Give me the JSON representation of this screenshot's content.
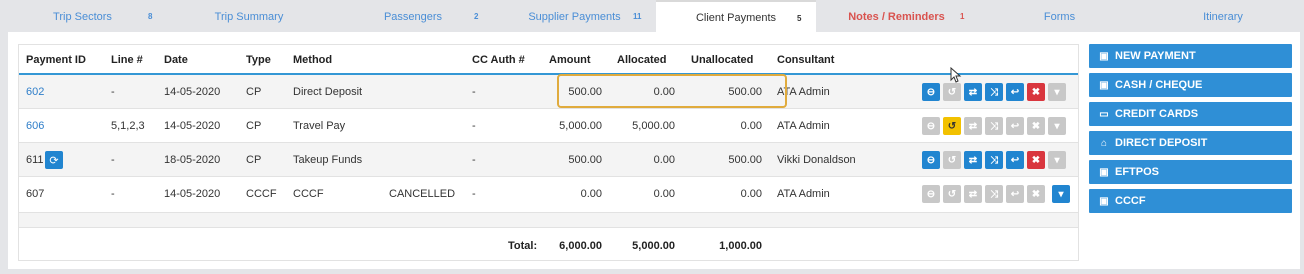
{
  "tabs": [
    {
      "label": "Trip Sectors",
      "count": "8"
    },
    {
      "label": "Trip Summary",
      "count": ""
    },
    {
      "label": "Passengers",
      "count": "2"
    },
    {
      "label": "Supplier Payments",
      "count": "11"
    },
    {
      "label": "Client Payments",
      "count": "5"
    },
    {
      "label": "Notes / Reminders",
      "count": "1"
    },
    {
      "label": "Forms",
      "count": ""
    },
    {
      "label": "Itinerary",
      "count": ""
    }
  ],
  "table": {
    "headers": {
      "payment_id": "Payment ID",
      "line": "Line #",
      "date": "Date",
      "type": "Type",
      "method": "Method",
      "cc_auth": "CC Auth #",
      "amount": "Amount",
      "allocated": "Allocated",
      "unallocated": "Unallocated",
      "consultant": "Consultant"
    },
    "rows": [
      {
        "payment_id": "602",
        "line": "-",
        "date": "14-05-2020",
        "type": "CP",
        "method": "Direct Deposit",
        "status": "",
        "cc_auth": "-",
        "amount": "500.00",
        "allocated": "0.00",
        "unallocated": "500.00",
        "consultant": "ATA Admin"
      },
      {
        "payment_id": "606",
        "line": "5,1,2,3",
        "date": "14-05-2020",
        "type": "CP",
        "method": "Travel Pay",
        "status": "",
        "cc_auth": "-",
        "amount": "5,000.00",
        "allocated": "5,000.00",
        "unallocated": "0.00",
        "consultant": "ATA Admin"
      },
      {
        "payment_id": "611",
        "line": "-",
        "date": "18-05-2020",
        "type": "CP",
        "method": "Takeup Funds",
        "status": "",
        "cc_auth": "-",
        "amount": "500.00",
        "allocated": "0.00",
        "unallocated": "500.00",
        "consultant": "Vikki Donaldson"
      },
      {
        "payment_id": "607",
        "line": "-",
        "date": "14-05-2020",
        "type": "CCCF",
        "method": "CCCF",
        "status": "CANCELLED",
        "cc_auth": "-",
        "amount": "0.00",
        "allocated": "0.00",
        "unallocated": "0.00",
        "consultant": "ATA Admin"
      }
    ],
    "totals": {
      "label": "Total:",
      "amount": "6,000.00",
      "allocated": "5,000.00",
      "unallocated": "1,000.00"
    }
  },
  "sidebar": {
    "buttons": [
      {
        "label": "NEW PAYMENT",
        "icon": "money-icon"
      },
      {
        "label": "CASH / CHEQUE",
        "icon": "money-icon"
      },
      {
        "label": "CREDIT CARDS",
        "icon": "credit-card-icon"
      },
      {
        "label": "DIRECT DEPOSIT",
        "icon": "bank-icon"
      },
      {
        "label": "EFTPOS",
        "icon": "money-icon"
      },
      {
        "label": "CCCF",
        "icon": "money-icon"
      }
    ]
  },
  "colors": {
    "accent": "#2f8fd6",
    "link": "#2f7ec9",
    "danger": "#d9363e",
    "warning": "#f2c100",
    "highlight": "#e0ab3d",
    "tab_alert": "#d9534f"
  }
}
